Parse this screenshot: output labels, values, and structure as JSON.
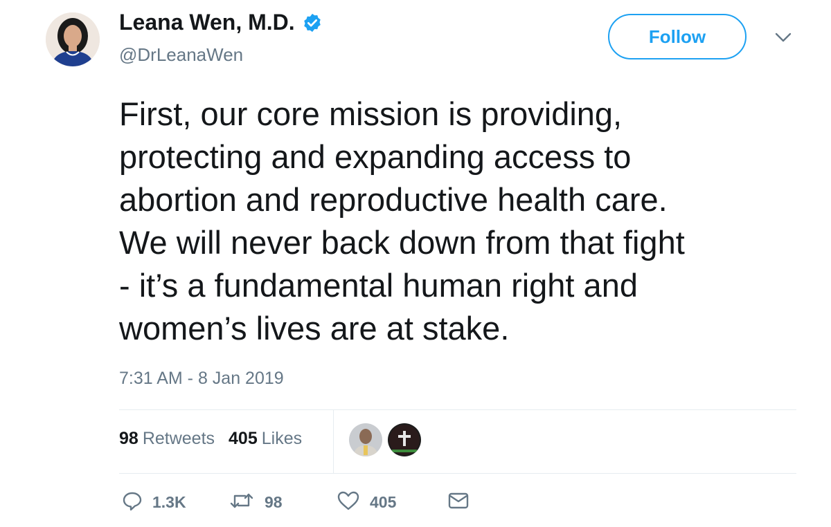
{
  "user": {
    "display_name": "Leana Wen, M.D.",
    "handle": "@DrLeanaWen",
    "verified": true
  },
  "header": {
    "follow_label": "Follow"
  },
  "tweet": {
    "text": "First, our core mission is providing,\nprotecting and expanding access to\nabortion and reproductive health care.\nWe will never back down from that fight\n- it’s a fundamental human right and\nwomen’s lives are at stake.",
    "timestamp": "7:31 AM - 8 Jan 2019"
  },
  "stats": {
    "retweets_count": "98",
    "retweets_label": "Retweets",
    "likes_count": "405",
    "likes_label": "Likes"
  },
  "actions": {
    "reply_count": "1.3K",
    "retweet_count": "98",
    "like_count": "405"
  },
  "colors": {
    "accent": "#1da1f2",
    "text": "#14171a",
    "muted": "#657786",
    "divider": "#e6ecf0"
  },
  "icons": [
    "verified-badge-icon",
    "chevron-down-icon",
    "reply-icon",
    "retweet-icon",
    "like-icon",
    "direct-message-icon"
  ]
}
